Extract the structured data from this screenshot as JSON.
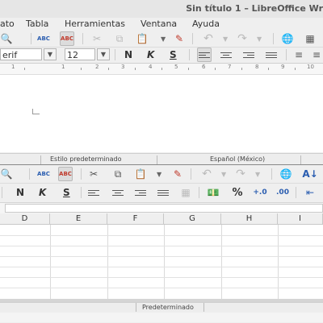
{
  "writer": {
    "window_title": "Sin título 1 – LibreOffice Wr",
    "menus": [
      "ato",
      "Tabla",
      "Herramientas",
      "Ventana",
      "Ayuda"
    ],
    "font_name": "erif",
    "font_size": "12",
    "format_letters": {
      "bold": "N",
      "italic": "K",
      "underline": "S"
    },
    "ruler_numbers": [
      "1",
      "1",
      "2",
      "3",
      "4",
      "5",
      "6",
      "7",
      "8",
      "9",
      "10"
    ],
    "status": {
      "page_style": "Estilo predeterminado",
      "language": "Español (México)"
    }
  },
  "calc": {
    "format_letters": {
      "bold": "N",
      "italic": "K",
      "underline": "S"
    },
    "percent_symbol": "%",
    "columns": [
      "D",
      "E",
      "F",
      "G",
      "H",
      "I"
    ],
    "status": {
      "page_style": "Predeterminado"
    }
  }
}
